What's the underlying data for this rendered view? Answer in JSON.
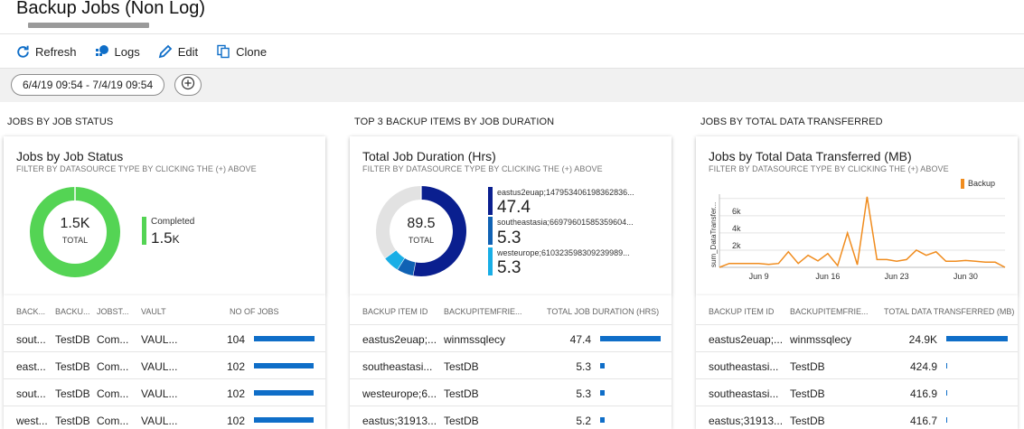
{
  "page": {
    "title": "Backup Jobs (Non Log)"
  },
  "toolbar": {
    "refresh": "Refresh",
    "logs": "Logs",
    "edit": "Edit",
    "clone": "Clone"
  },
  "filter": {
    "date_range": "6/4/19 09:54 - 7/4/19 09:54"
  },
  "sections": {
    "s1": "JOBS BY JOB STATUS",
    "s2": "TOP 3 BACKUP ITEMS BY JOB DURATION",
    "s3": "JOBS BY TOTAL DATA TRANSFERRED"
  },
  "cards": {
    "c1": {
      "title": "Jobs by Job Status",
      "subtitle": "FILTER BY DATASOURCE TYPE BY CLICKING THE (+) ABOVE",
      "center_value": "1.5K",
      "center_label": "TOTAL",
      "legend_name": "Completed",
      "legend_value": "1.5",
      "legend_unit": "K",
      "color": "#54d454"
    },
    "c2": {
      "title": "Total Job Duration (Hrs)",
      "subtitle": "FILTER BY DATASOURCE TYPE BY CLICKING THE (+) ABOVE",
      "center_value": "89.5",
      "center_label": "TOTAL",
      "legend": [
        {
          "name": "eastus2euap;147953406198362836...",
          "value": "47.4",
          "color": "#0a1f8f"
        },
        {
          "name": "southeastasia;66979601585359604...",
          "value": "5.3",
          "color": "#1062b4"
        },
        {
          "name": "westeurope;610323598309239989...",
          "value": "5.3",
          "color": "#19aee6"
        }
      ]
    },
    "c3": {
      "title": "Jobs by Total Data Transferred (MB)",
      "subtitle": "FILTER BY DATASOURCE TYPE BY CLICKING THE (+) ABOVE",
      "legend": "Backup",
      "ylabel": "sum_DataTransfer...",
      "color": "#f08c1e"
    }
  },
  "grid1": {
    "headers": [
      "BACK...",
      "BACKU...",
      "JOBST...",
      "VAULT",
      "NO OF JOBS"
    ],
    "rows": [
      {
        "c1": "sout...",
        "c2": "TestDB",
        "c3": "Com...",
        "c4": "VAUL...",
        "n": "104"
      },
      {
        "c1": "east...",
        "c2": "TestDB",
        "c3": "Com...",
        "c4": "VAUL...",
        "n": "102"
      },
      {
        "c1": "sout...",
        "c2": "TestDB",
        "c3": "Com...",
        "c4": "VAUL...",
        "n": "102"
      },
      {
        "c1": "west...",
        "c2": "TestDB",
        "c3": "Com...",
        "c4": "VAUL...",
        "n": "102"
      }
    ]
  },
  "grid2": {
    "headers": [
      "BACKUP ITEM ID",
      "BACKUPITEMFRIE...",
      "TOTAL JOB DURATION (HRS)"
    ],
    "rows": [
      {
        "c1": "eastus2euap;...",
        "c2": "winmssqlecy",
        "n": "47.4"
      },
      {
        "c1": "southeastasi...",
        "c2": "TestDB",
        "n": "5.3"
      },
      {
        "c1": "westeurope;6...",
        "c2": "TestDB",
        "n": "5.3"
      },
      {
        "c1": "eastus;31913...",
        "c2": "TestDB",
        "n": "5.2"
      }
    ]
  },
  "grid3": {
    "headers": [
      "BACKUP ITEM ID",
      "BACKUPITEMFRIE...",
      "TOTAL DATA TRANSFERRED (MB)"
    ],
    "rows": [
      {
        "c1": "eastus2euap;...",
        "c2": "winmssqlecy",
        "n": "24.9K"
      },
      {
        "c1": "southeastasi...",
        "c2": "TestDB",
        "n": "424.9"
      },
      {
        "c1": "southeastasi...",
        "c2": "TestDB",
        "n": "416.9"
      },
      {
        "c1": "eastus;31913...",
        "c2": "TestDB",
        "n": "416.7"
      }
    ]
  },
  "chart_data": [
    {
      "type": "pie",
      "title": "Jobs by Job Status",
      "categories": [
        "Completed"
      ],
      "values": [
        1500
      ]
    },
    {
      "type": "pie",
      "title": "Total Job Duration (Hrs)",
      "categories": [
        "eastus2euap;147953406198362836...",
        "southeastasia;66979601585359604...",
        "westeurope;610323598309239989...",
        "Other"
      ],
      "values": [
        47.4,
        5.3,
        5.3,
        31.5
      ],
      "colors": [
        "#0a1f8f",
        "#1062b4",
        "#19aee6",
        "#e2e2e2"
      ]
    },
    {
      "type": "line",
      "title": "Jobs by Total Data Transferred (MB)",
      "ylabel": "sum_DataTransfer...",
      "x_ticks": [
        "Jun 9",
        "Jun 16",
        "Jun 23",
        "Jun 30"
      ],
      "yticks": [
        "2k",
        "4k",
        "6k"
      ],
      "ylim": [
        0,
        8500
      ],
      "series": [
        {
          "name": "Backup",
          "x": [
            "Jun 5",
            "Jun 6",
            "Jun 7",
            "Jun 8",
            "Jun 9",
            "Jun 10",
            "Jun 11",
            "Jun 12",
            "Jun 13",
            "Jun 14",
            "Jun 15",
            "Jun 16",
            "Jun 17",
            "Jun 18",
            "Jun 19",
            "Jun 20",
            "Jun 21",
            "Jun 22",
            "Jun 23",
            "Jun 24",
            "Jun 25",
            "Jun 26",
            "Jun 27",
            "Jun 28",
            "Jun 29",
            "Jun 30",
            "Jul 1",
            "Jul 2",
            "Jul 3",
            "Jul 4"
          ],
          "values": [
            0,
            450,
            450,
            450,
            450,
            350,
            450,
            1800,
            450,
            1400,
            750,
            1600,
            200,
            4000,
            300,
            8200,
            900,
            900,
            700,
            900,
            2000,
            1400,
            1800,
            700,
            700,
            800,
            700,
            600,
            600,
            0
          ]
        }
      ]
    }
  ]
}
